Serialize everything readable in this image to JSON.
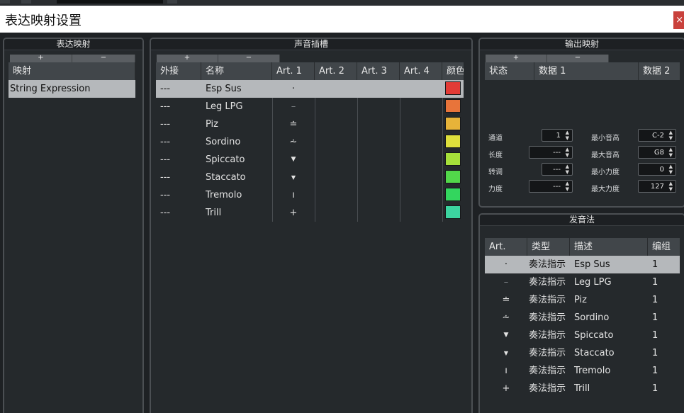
{
  "window": {
    "title": "表达映射设置",
    "close_glyph": "×"
  },
  "panels": {
    "expression_maps": {
      "header": "表达映射",
      "plus": "+",
      "minus": "−",
      "column": "映射",
      "items": [
        "String Expression"
      ]
    },
    "sound_slots": {
      "header": "声音插槽",
      "plus": "+",
      "minus": "−",
      "columns": [
        "外接",
        "名称",
        "Art. 1",
        "Art. 2",
        "Art. 3",
        "Art. 4",
        "颜色"
      ],
      "rows": [
        {
          "remote": "---",
          "name": "Esp Sus",
          "art1": "·",
          "color": "#e23b36"
        },
        {
          "remote": "---",
          "name": "Leg LPG",
          "art1": "–",
          "color": "#e8743a"
        },
        {
          "remote": "---",
          "name": "Piz",
          "art1": "≐",
          "color": "#e7b339"
        },
        {
          "remote": "---",
          "name": "Sordino",
          "art1": "⩪",
          "color": "#dfe03c"
        },
        {
          "remote": "---",
          "name": "Spiccato",
          "art1": "▼",
          "color": "#a6e03a"
        },
        {
          "remote": "---",
          "name": "Staccato",
          "art1": "▼",
          "color": "#52d84a"
        },
        {
          "remote": "---",
          "name": "Tremolo",
          "art1": "ı",
          "color": "#33d65e"
        },
        {
          "remote": "---",
          "name": "Trill",
          "art1": "+",
          "color": "#3cd4a0"
        }
      ]
    },
    "output_mapping": {
      "header": "输出映射",
      "plus": "+",
      "minus": "−",
      "columns": [
        "状态",
        "数据 1",
        "数据 2"
      ],
      "fields": {
        "channel": {
          "label": "通道",
          "value": "1"
        },
        "length": {
          "label": "长度",
          "value": "---"
        },
        "transpose": {
          "label": "转调",
          "value": "---"
        },
        "velocity": {
          "label": "力度",
          "value": "---"
        },
        "min_pitch": {
          "label": "最小音高",
          "value": "C-2"
        },
        "max_pitch": {
          "label": "最大音高",
          "value": "G8"
        },
        "min_velocity": {
          "label": "最小力度",
          "value": "0"
        },
        "max_velocity": {
          "label": "最大力度",
          "value": "127"
        }
      }
    },
    "articulations": {
      "header": "发音法",
      "columns": [
        "Art.",
        "类型",
        "描述",
        "编组"
      ],
      "rows": [
        {
          "art": "·",
          "type": "奏法指示",
          "desc": "Esp Sus",
          "group": "1"
        },
        {
          "art": "–",
          "type": "奏法指示",
          "desc": "Leg LPG",
          "group": "1"
        },
        {
          "art": "≐",
          "type": "奏法指示",
          "desc": "Piz",
          "group": "1"
        },
        {
          "art": "⩪",
          "type": "奏法指示",
          "desc": "Sordino",
          "group": "1"
        },
        {
          "art": "▼",
          "type": "奏法指示",
          "desc": "Spiccato",
          "group": "1"
        },
        {
          "art": "▼",
          "type": "奏法指示",
          "desc": "Staccato",
          "group": "1"
        },
        {
          "art": "ı",
          "type": "奏法指示",
          "desc": "Tremolo",
          "group": "1"
        },
        {
          "art": "+",
          "type": "奏法指示",
          "desc": "Trill",
          "group": "1"
        }
      ]
    }
  },
  "colors": {
    "selection": "#b5b8bb",
    "header_bg": "#41464a",
    "panel_bg": "#25292c",
    "close": "#c9413c"
  }
}
